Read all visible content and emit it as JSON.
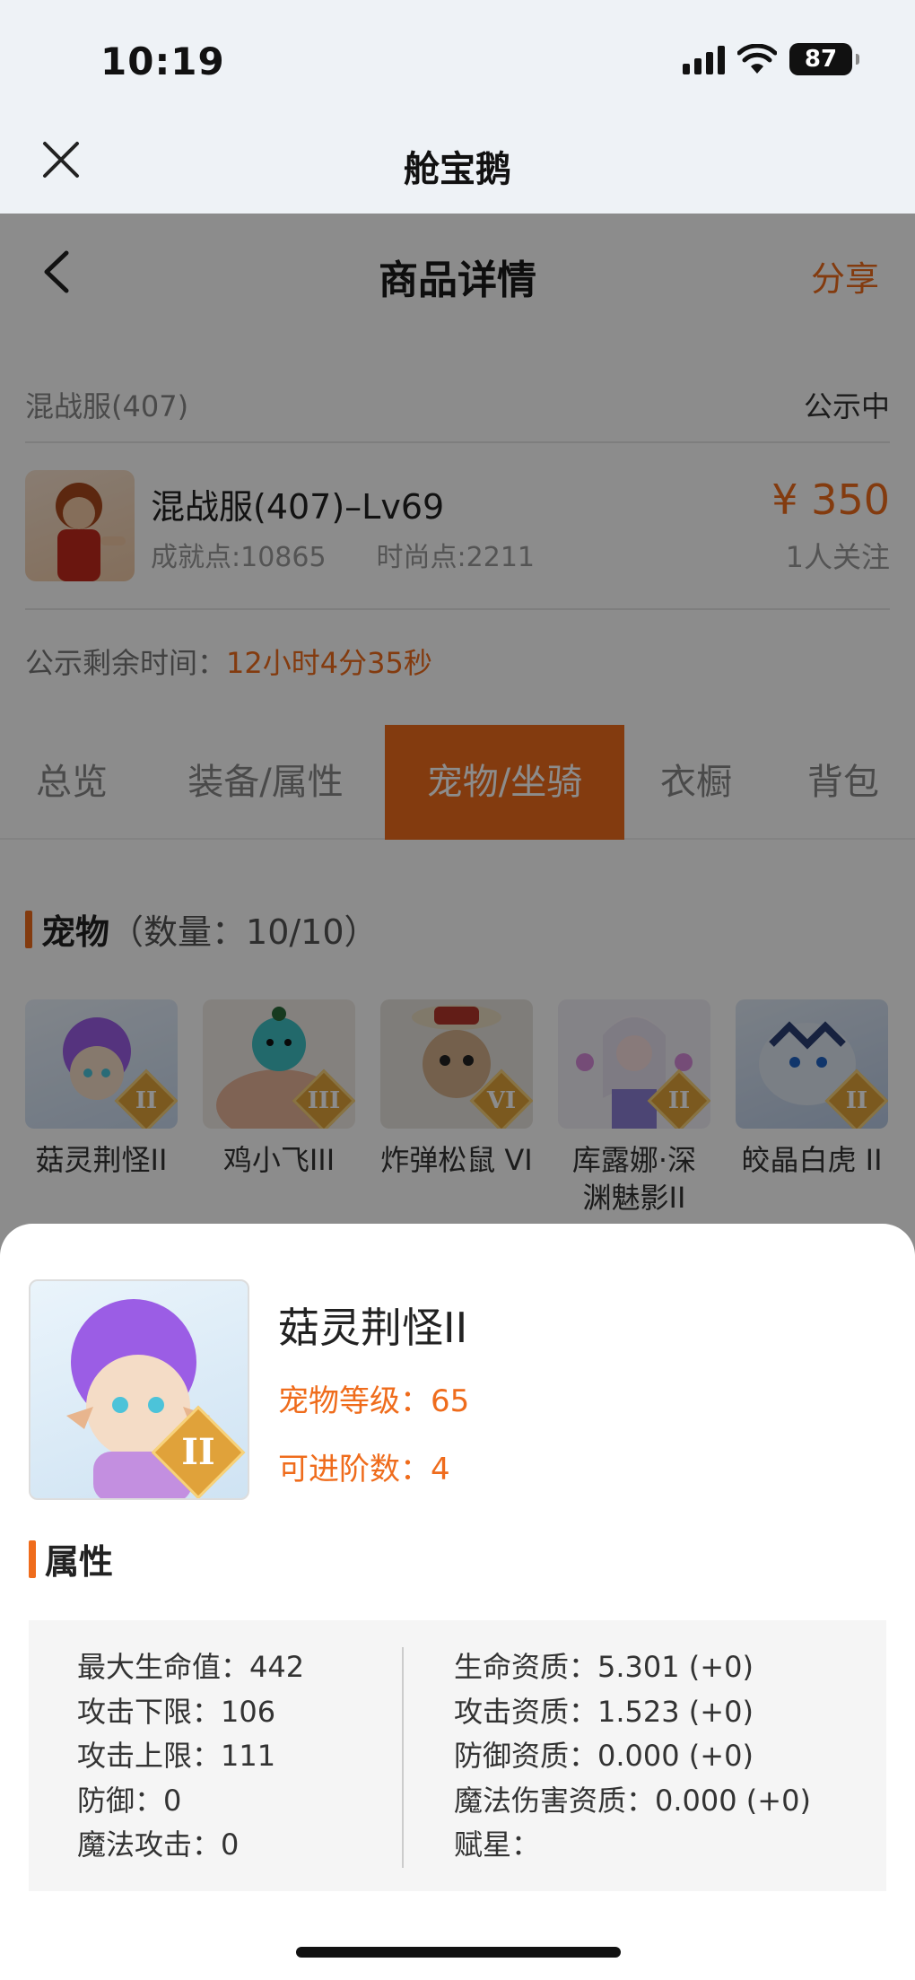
{
  "status_bar": {
    "time": "10:19",
    "battery": "87"
  },
  "app_header": {
    "title": "舱宝鹅"
  },
  "nav": {
    "title": "商品详情",
    "share": "分享"
  },
  "server_row": {
    "server": "混战服(407)",
    "status": "公示中"
  },
  "product": {
    "name": "混战服(407)–Lv69",
    "achievement": "成就点:10865",
    "fashion": "时尚点:2211",
    "price": "¥ 350",
    "watchers": "1人关注"
  },
  "remaining": {
    "label": "公示剩余时间：",
    "value": "12小时4分35秒"
  },
  "tabs": [
    "总览",
    "装备/属性",
    "宠物/坐骑",
    "衣橱",
    "背包"
  ],
  "pets_section": {
    "title": "宠物",
    "count": "（数量：10/10）"
  },
  "pets": [
    {
      "name": "菇灵荆怪II",
      "grade": "II"
    },
    {
      "name": "鸡小飞III",
      "grade": "III"
    },
    {
      "name": "炸弹松鼠 VI",
      "grade": "VI"
    },
    {
      "name": "库露娜·深渊魅影II",
      "grade": "II"
    },
    {
      "name": "皎晶白虎 II",
      "grade": "II"
    }
  ],
  "detail": {
    "name": "菇灵荆怪II",
    "grade": "II",
    "level": "宠物等级：65",
    "advance": "可进阶数：4",
    "attr_title": "属性",
    "left_attrs": [
      "最大生命值：442",
      "攻击下限：106",
      "攻击上限：111",
      "防御：0",
      "魔法攻击：0"
    ],
    "right_attrs": [
      "生命资质：5.301 (+0)",
      "攻击资质：1.523 (+0)",
      "防御资质：0.000 (+0)",
      "魔法伤害资质：0.000 (+0)",
      "赋星："
    ]
  },
  "colors": {
    "accent": "#ef6c1c",
    "overlay": "rgba(0,0,0,0.45)"
  }
}
